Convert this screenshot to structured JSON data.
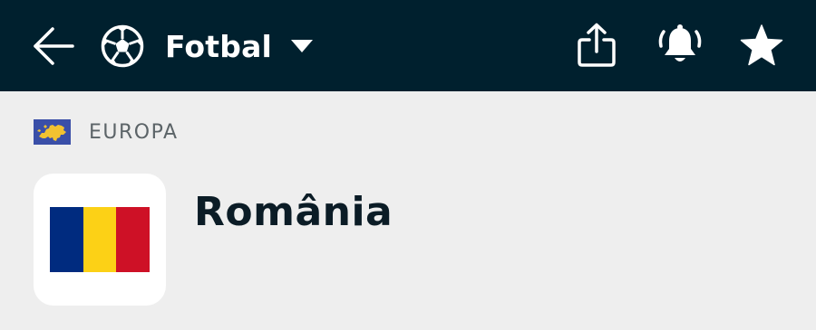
{
  "header": {
    "back_icon": "arrow-left-icon",
    "sport_icon": "soccer-ball-icon",
    "sport_label": "Fotbal",
    "dropdown_icon": "caret-down-icon",
    "share_icon": "share-icon",
    "notification_icon": "bell-ringing-icon",
    "favorite_icon": "star-icon",
    "background_color": "#00202e"
  },
  "region": {
    "flag_icon": "europe-flag-icon",
    "label": "EUROPA"
  },
  "team": {
    "name": "România",
    "flag_colors": [
      "#002b7f",
      "#fcd116",
      "#ce1126"
    ]
  }
}
